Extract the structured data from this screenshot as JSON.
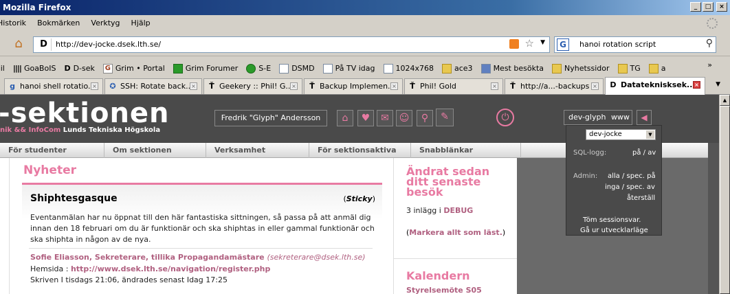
{
  "window": {
    "title": "Mozilla Firefox",
    "buttons": {
      "min": "_",
      "max": "□",
      "close": "×"
    }
  },
  "menu": [
    "Historik",
    "Bokmärken",
    "Verktyg",
    "Hjälp"
  ],
  "nav": {
    "url": "http://dev-jocke.dsek.lth.se/",
    "search": "hanoi rotation script",
    "url_icon": "D",
    "search_icon": "G"
  },
  "bookmarks": [
    {
      "label": "ail",
      "icon": "none"
    },
    {
      "label": "GoaBoIS",
      "icon": "bars"
    },
    {
      "label": "D-sek",
      "icon": "dsek"
    },
    {
      "label": "Grim • Portal",
      "icon": "G"
    },
    {
      "label": "Grim Forumer",
      "icon": "F"
    },
    {
      "label": "S-E",
      "icon": "green"
    },
    {
      "label": "DSMD",
      "icon": "page"
    },
    {
      "label": "På TV idag",
      "icon": "page"
    },
    {
      "label": "1024x768",
      "icon": "page"
    },
    {
      "label": "ace3",
      "icon": "folder"
    },
    {
      "label": "Mest besökta",
      "icon": "folder"
    },
    {
      "label": "Nyhetssidor",
      "icon": "folder"
    },
    {
      "label": "TG",
      "icon": "folder"
    },
    {
      "label": "a",
      "icon": "folder"
    }
  ],
  "bookmarks_more": "»",
  "tabs": [
    {
      "label": "hanoi shell rotatio...",
      "icon": "google"
    },
    {
      "label": "SSH: Rotate back...",
      "icon": "ssh"
    },
    {
      "label": "Geekery :: Phil! G...",
      "icon": "tt"
    },
    {
      "label": "Backup Implemen...",
      "icon": "tt"
    },
    {
      "label": "Phil! Gold",
      "icon": "tt"
    },
    {
      "label": "http://a...-backups",
      "icon": "tt"
    },
    {
      "label": "Datateknisksek...",
      "icon": "dsek",
      "active": true
    }
  ],
  "site": {
    "logo": "-sektionen",
    "sub_pink": "nik && InfoCom",
    "sub_white": " Lunds Tekniska Högskola",
    "user": "Fredrik \"Glyph\" Andersson",
    "dev_user": "dev-glyph",
    "dev_env": "www",
    "menu": [
      "För studenter",
      "Om sektionen",
      "Verksamhet",
      "För sektionsaktiva",
      "Snabblänkar"
    ]
  },
  "news": {
    "heading": "Nyheter",
    "title": "Shiphtesgasque",
    "sticky_open": "(",
    "sticky": "Sticky",
    "sticky_close": ")",
    "body": "Eventanmälan har nu öppnat till den här fantastiska sittningen, så passa på att anmäl dig innan den 18 februari om du är funktionär och ska shiphtas in eller gammal funktionär och ska shiphta in någon av de nya.",
    "author": "Sofie Eliasson, Sekreterare, tillika Propagandamästare",
    "author_email": "(sekreterare@dsek.lth.se)",
    "homepage_label": "Hemsida : ",
    "homepage_url": "http://www.dsek.lth.se/navigation/register.php",
    "written": "Skriven I tisdags 21:06, ändrades senast Idag 17:25"
  },
  "sidebar": {
    "changed_title": "Ändrat sedan ditt senaste besök",
    "posts_text": "3 inlägg i ",
    "posts_link": "DEBUG",
    "mark_open": "(",
    "mark_link": "Markera allt som läst.",
    "mark_close": ")",
    "calendar_title": "Kalendern",
    "calendar_item": "Styrelsemöte S05"
  },
  "devpanel": {
    "select": "dev-jocke",
    "sql_label": "SQL-logg:",
    "sql_value": "på / av",
    "admin_label": "Admin:",
    "admin_line1": "alla / spec. på",
    "admin_line2": "inga / spec. av",
    "admin_line3": "återställ",
    "clear": "Töm sessionsvar.",
    "leave": "Gå ur utvecklarläge"
  },
  "colors": {
    "pink": "#e87aa2",
    "dark": "#4a4a4a"
  }
}
